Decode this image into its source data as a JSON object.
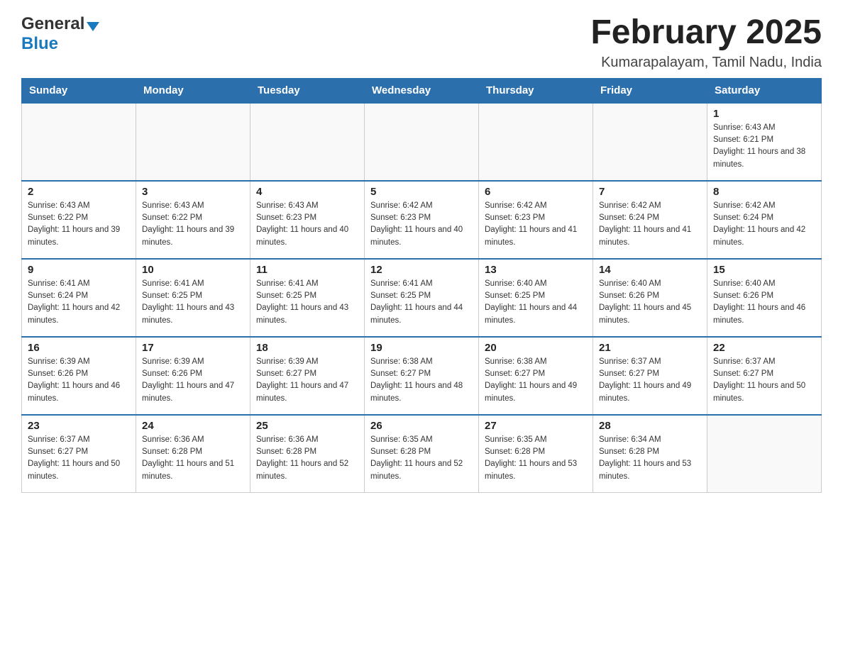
{
  "header": {
    "logo_general": "General",
    "logo_blue": "Blue",
    "month_title": "February 2025",
    "location": "Kumarapalayam, Tamil Nadu, India"
  },
  "days_of_week": [
    "Sunday",
    "Monday",
    "Tuesday",
    "Wednesday",
    "Thursday",
    "Friday",
    "Saturday"
  ],
  "weeks": [
    [
      {
        "day": "",
        "sunrise": "",
        "sunset": "",
        "daylight": "",
        "empty": true
      },
      {
        "day": "",
        "sunrise": "",
        "sunset": "",
        "daylight": "",
        "empty": true
      },
      {
        "day": "",
        "sunrise": "",
        "sunset": "",
        "daylight": "",
        "empty": true
      },
      {
        "day": "",
        "sunrise": "",
        "sunset": "",
        "daylight": "",
        "empty": true
      },
      {
        "day": "",
        "sunrise": "",
        "sunset": "",
        "daylight": "",
        "empty": true
      },
      {
        "day": "",
        "sunrise": "",
        "sunset": "",
        "daylight": "",
        "empty": true
      },
      {
        "day": "1",
        "sunrise": "Sunrise: 6:43 AM",
        "sunset": "Sunset: 6:21 PM",
        "daylight": "Daylight: 11 hours and 38 minutes.",
        "empty": false
      }
    ],
    [
      {
        "day": "2",
        "sunrise": "Sunrise: 6:43 AM",
        "sunset": "Sunset: 6:22 PM",
        "daylight": "Daylight: 11 hours and 39 minutes.",
        "empty": false
      },
      {
        "day": "3",
        "sunrise": "Sunrise: 6:43 AM",
        "sunset": "Sunset: 6:22 PM",
        "daylight": "Daylight: 11 hours and 39 minutes.",
        "empty": false
      },
      {
        "day": "4",
        "sunrise": "Sunrise: 6:43 AM",
        "sunset": "Sunset: 6:23 PM",
        "daylight": "Daylight: 11 hours and 40 minutes.",
        "empty": false
      },
      {
        "day": "5",
        "sunrise": "Sunrise: 6:42 AM",
        "sunset": "Sunset: 6:23 PM",
        "daylight": "Daylight: 11 hours and 40 minutes.",
        "empty": false
      },
      {
        "day": "6",
        "sunrise": "Sunrise: 6:42 AM",
        "sunset": "Sunset: 6:23 PM",
        "daylight": "Daylight: 11 hours and 41 minutes.",
        "empty": false
      },
      {
        "day": "7",
        "sunrise": "Sunrise: 6:42 AM",
        "sunset": "Sunset: 6:24 PM",
        "daylight": "Daylight: 11 hours and 41 minutes.",
        "empty": false
      },
      {
        "day": "8",
        "sunrise": "Sunrise: 6:42 AM",
        "sunset": "Sunset: 6:24 PM",
        "daylight": "Daylight: 11 hours and 42 minutes.",
        "empty": false
      }
    ],
    [
      {
        "day": "9",
        "sunrise": "Sunrise: 6:41 AM",
        "sunset": "Sunset: 6:24 PM",
        "daylight": "Daylight: 11 hours and 42 minutes.",
        "empty": false
      },
      {
        "day": "10",
        "sunrise": "Sunrise: 6:41 AM",
        "sunset": "Sunset: 6:25 PM",
        "daylight": "Daylight: 11 hours and 43 minutes.",
        "empty": false
      },
      {
        "day": "11",
        "sunrise": "Sunrise: 6:41 AM",
        "sunset": "Sunset: 6:25 PM",
        "daylight": "Daylight: 11 hours and 43 minutes.",
        "empty": false
      },
      {
        "day": "12",
        "sunrise": "Sunrise: 6:41 AM",
        "sunset": "Sunset: 6:25 PM",
        "daylight": "Daylight: 11 hours and 44 minutes.",
        "empty": false
      },
      {
        "day": "13",
        "sunrise": "Sunrise: 6:40 AM",
        "sunset": "Sunset: 6:25 PM",
        "daylight": "Daylight: 11 hours and 44 minutes.",
        "empty": false
      },
      {
        "day": "14",
        "sunrise": "Sunrise: 6:40 AM",
        "sunset": "Sunset: 6:26 PM",
        "daylight": "Daylight: 11 hours and 45 minutes.",
        "empty": false
      },
      {
        "day": "15",
        "sunrise": "Sunrise: 6:40 AM",
        "sunset": "Sunset: 6:26 PM",
        "daylight": "Daylight: 11 hours and 46 minutes.",
        "empty": false
      }
    ],
    [
      {
        "day": "16",
        "sunrise": "Sunrise: 6:39 AM",
        "sunset": "Sunset: 6:26 PM",
        "daylight": "Daylight: 11 hours and 46 minutes.",
        "empty": false
      },
      {
        "day": "17",
        "sunrise": "Sunrise: 6:39 AM",
        "sunset": "Sunset: 6:26 PM",
        "daylight": "Daylight: 11 hours and 47 minutes.",
        "empty": false
      },
      {
        "day": "18",
        "sunrise": "Sunrise: 6:39 AM",
        "sunset": "Sunset: 6:27 PM",
        "daylight": "Daylight: 11 hours and 47 minutes.",
        "empty": false
      },
      {
        "day": "19",
        "sunrise": "Sunrise: 6:38 AM",
        "sunset": "Sunset: 6:27 PM",
        "daylight": "Daylight: 11 hours and 48 minutes.",
        "empty": false
      },
      {
        "day": "20",
        "sunrise": "Sunrise: 6:38 AM",
        "sunset": "Sunset: 6:27 PM",
        "daylight": "Daylight: 11 hours and 49 minutes.",
        "empty": false
      },
      {
        "day": "21",
        "sunrise": "Sunrise: 6:37 AM",
        "sunset": "Sunset: 6:27 PM",
        "daylight": "Daylight: 11 hours and 49 minutes.",
        "empty": false
      },
      {
        "day": "22",
        "sunrise": "Sunrise: 6:37 AM",
        "sunset": "Sunset: 6:27 PM",
        "daylight": "Daylight: 11 hours and 50 minutes.",
        "empty": false
      }
    ],
    [
      {
        "day": "23",
        "sunrise": "Sunrise: 6:37 AM",
        "sunset": "Sunset: 6:27 PM",
        "daylight": "Daylight: 11 hours and 50 minutes.",
        "empty": false
      },
      {
        "day": "24",
        "sunrise": "Sunrise: 6:36 AM",
        "sunset": "Sunset: 6:28 PM",
        "daylight": "Daylight: 11 hours and 51 minutes.",
        "empty": false
      },
      {
        "day": "25",
        "sunrise": "Sunrise: 6:36 AM",
        "sunset": "Sunset: 6:28 PM",
        "daylight": "Daylight: 11 hours and 52 minutes.",
        "empty": false
      },
      {
        "day": "26",
        "sunrise": "Sunrise: 6:35 AM",
        "sunset": "Sunset: 6:28 PM",
        "daylight": "Daylight: 11 hours and 52 minutes.",
        "empty": false
      },
      {
        "day": "27",
        "sunrise": "Sunrise: 6:35 AM",
        "sunset": "Sunset: 6:28 PM",
        "daylight": "Daylight: 11 hours and 53 minutes.",
        "empty": false
      },
      {
        "day": "28",
        "sunrise": "Sunrise: 6:34 AM",
        "sunset": "Sunset: 6:28 PM",
        "daylight": "Daylight: 11 hours and 53 minutes.",
        "empty": false
      },
      {
        "day": "",
        "sunrise": "",
        "sunset": "",
        "daylight": "",
        "empty": true
      }
    ]
  ]
}
